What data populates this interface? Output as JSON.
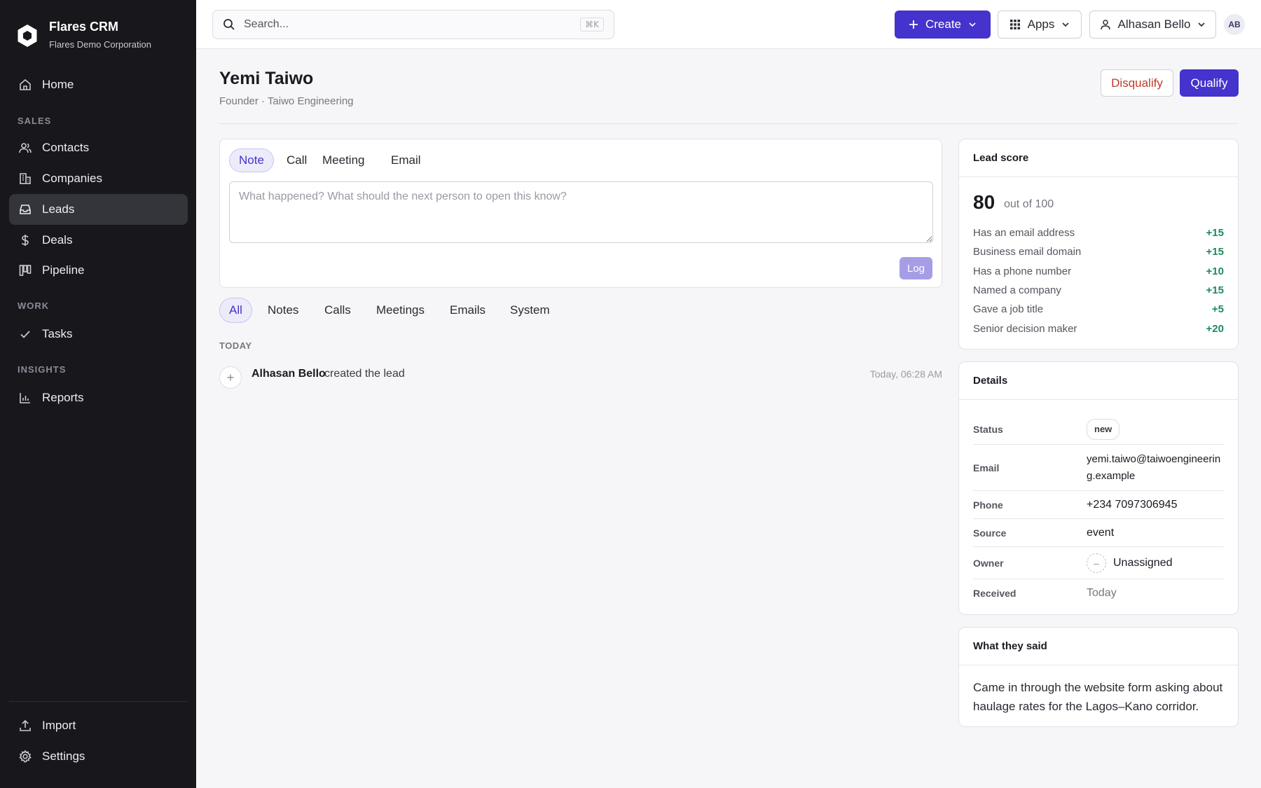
{
  "app": {
    "name": "Flares CRM",
    "org": "Flares Demo Corporation"
  },
  "sidebar": {
    "home": "Home",
    "section_sales": "SALES",
    "contacts": "Contacts",
    "companies": "Companies",
    "leads": "Leads",
    "deals": "Deals",
    "pipeline": "Pipeline",
    "section_work": "WORK",
    "tasks": "Tasks",
    "section_insights": "INSIGHTS",
    "reports": "Reports",
    "import": "Import",
    "settings": "Settings",
    "active_item": "Leads"
  },
  "topbar": {
    "search_placeholder": "Search...",
    "search_shortcut": "⌘K",
    "create_label": "Create",
    "apps_label": "Apps",
    "user_label": "Alhasan Bello",
    "avatar_initials": "AB"
  },
  "lead": {
    "name": "Yemi Taiwo",
    "subtitle": "Founder · Taiwo Engineering",
    "disqualify_label": "Disqualify",
    "qualify_label": "Qualify"
  },
  "composer": {
    "tabs": [
      "Note",
      "Call",
      "Meeting",
      "Email"
    ],
    "active_tab": "Note",
    "placeholder": "What happened? What should the next person to open this know?",
    "log_label": "Log"
  },
  "activity": {
    "filters": [
      "All",
      "Notes",
      "Calls",
      "Meetings",
      "Emails",
      "System"
    ],
    "active_filter": "All",
    "group_label": "TODAY",
    "events": [
      {
        "actor": "Alhasan Bello",
        "action": "created the lead",
        "time": "Today, 06:28 AM"
      }
    ]
  },
  "lead_score": {
    "title": "Lead score",
    "score": "80",
    "out_of": "out of 100",
    "rows": [
      {
        "label": "Has an email address",
        "points": "+15"
      },
      {
        "label": "Business email domain",
        "points": "+15"
      },
      {
        "label": "Has a phone number",
        "points": "+10"
      },
      {
        "label": "Named a company",
        "points": "+15"
      },
      {
        "label": "Gave a job title",
        "points": "+5"
      },
      {
        "label": "Senior decision maker",
        "points": "+20"
      }
    ]
  },
  "details": {
    "title": "Details",
    "status_label": "Status",
    "status_value": "new",
    "email_label": "Email",
    "email_value": "yemi.taiwo@taiwoengineering.example",
    "phone_label": "Phone",
    "phone_value": "+234 7097306945",
    "source_label": "Source",
    "source_value": "event",
    "owner_label": "Owner",
    "owner_value": "Unassigned",
    "received_label": "Received",
    "received_value": "Today"
  },
  "what_they_said": {
    "title": "What they said",
    "text": "Came in through the website form asking about haulage rates for the Lagos–Kano corridor."
  },
  "colors": {
    "accent": "#4433cc",
    "sidebar_bg": "#17171c",
    "positive": "#1f8a5b",
    "danger": "#c0392b"
  }
}
